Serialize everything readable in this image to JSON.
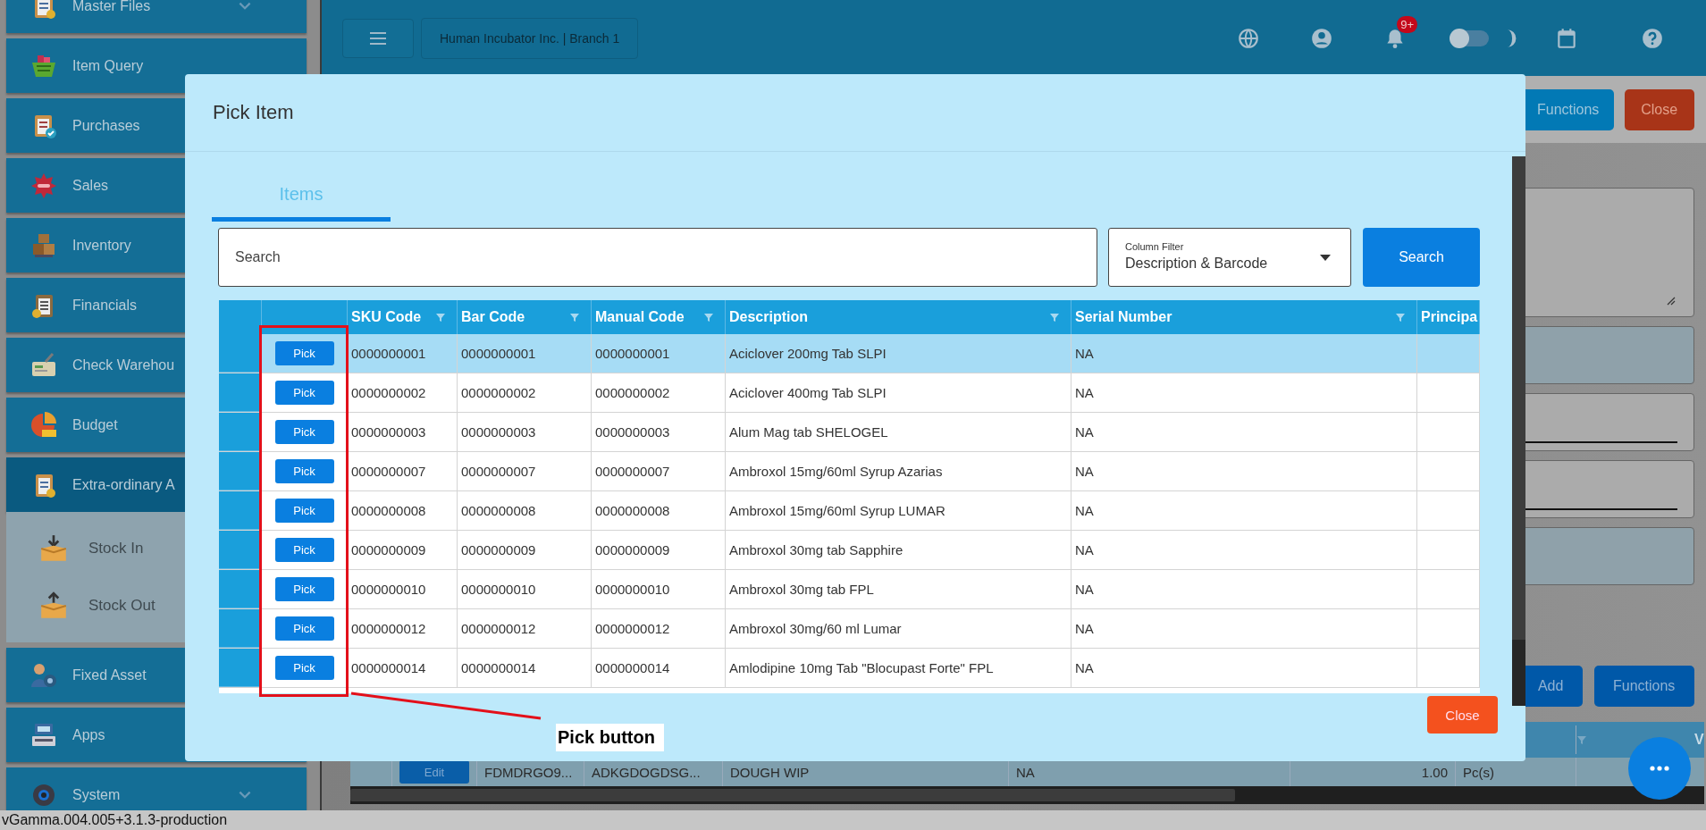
{
  "sidebar": {
    "items": [
      {
        "label": "Master Files",
        "caret": true,
        "expanded": false
      },
      {
        "label": "Item Query",
        "expanded": false
      },
      {
        "label": "Purchases",
        "expanded": false
      },
      {
        "label": "Sales",
        "expanded": false
      },
      {
        "label": "Inventory",
        "expanded": false
      },
      {
        "label": "Financials",
        "expanded": false
      },
      {
        "label": "Check Warehou",
        "expanded": false
      },
      {
        "label": "Budget",
        "expanded": false
      },
      {
        "label": "Extra-ordinary A",
        "expanded": true,
        "children": [
          {
            "label": "Stock In"
          },
          {
            "label": "Stock Out"
          }
        ]
      },
      {
        "label": "Fixed Asset",
        "expanded": false
      },
      {
        "label": "Apps",
        "expanded": false
      },
      {
        "label": "System",
        "caret": true,
        "expanded": false
      }
    ]
  },
  "top_bar": {
    "company": "Human Incubator Inc. | Branch 1",
    "notification_count": "9+",
    "theme_toggle": {
      "on": false
    }
  },
  "page": {
    "top_buttons": [
      "Functions",
      "Close"
    ],
    "lower_buttons": [
      "Add",
      "Functions"
    ],
    "table": {
      "last_header": "V",
      "row": {
        "button": "Edit",
        "cells": [
          "FDMDRGO9...",
          "ADKGDOGDSG...",
          "DOUGH WIP",
          "NA",
          "1.00",
          "Pc(s)"
        ]
      }
    }
  },
  "modal": {
    "title": "Pick Item",
    "tabs": [
      {
        "label": "Items",
        "selected": true
      }
    ],
    "search": {
      "placeholder": "Search"
    },
    "column_filter": {
      "label": "Column Filter",
      "value": "Description & Barcode"
    },
    "search_button": "Search",
    "table": {
      "columns": [
        {
          "label": "SKU Code",
          "filter": true
        },
        {
          "label": "Bar Code",
          "filter": true
        },
        {
          "label": "Manual Code",
          "filter": true
        },
        {
          "label": "Description",
          "filter": true
        },
        {
          "label": "Serial Number",
          "filter": true
        },
        {
          "label": "Principa"
        }
      ],
      "rows": [
        {
          "pick": "Pick",
          "selected": true,
          "cells": [
            "0000000001",
            "0000000001",
            "0000000001",
            "Aciclover 200mg Tab SLPI",
            "NA"
          ]
        },
        {
          "pick": "Pick",
          "selected": false,
          "cells": [
            "0000000002",
            "0000000002",
            "0000000002",
            "Aciclover 400mg Tab SLPI",
            "NA"
          ]
        },
        {
          "pick": "Pick",
          "selected": false,
          "cells": [
            "0000000003",
            "0000000003",
            "0000000003",
            "Alum Mag tab SHELOGEL",
            "NA"
          ]
        },
        {
          "pick": "Pick",
          "selected": false,
          "cells": [
            "0000000007",
            "0000000007",
            "0000000007",
            "Ambroxol 15mg/60ml Syrup Azarias",
            "NA"
          ]
        },
        {
          "pick": "Pick",
          "selected": false,
          "cells": [
            "0000000008",
            "0000000008",
            "0000000008",
            "Ambroxol 15mg/60ml Syrup LUMAR",
            "NA"
          ]
        },
        {
          "pick": "Pick",
          "selected": false,
          "cells": [
            "0000000009",
            "0000000009",
            "0000000009",
            "Ambroxol 30mg tab Sapphire",
            "NA"
          ]
        },
        {
          "pick": "Pick",
          "selected": false,
          "cells": [
            "0000000010",
            "0000000010",
            "0000000010",
            "Ambroxol 30mg tab FPL",
            "NA"
          ]
        },
        {
          "pick": "Pick",
          "selected": false,
          "cells": [
            "0000000012",
            "0000000012",
            "0000000012",
            "Ambroxol 30mg/60 ml Lumar",
            "NA"
          ]
        },
        {
          "pick": "Pick",
          "selected": false,
          "cells": [
            "0000000014",
            "0000000014",
            "0000000014",
            "Amlodipine 10mg Tab \"Blocupast Forte\" FPL",
            "NA"
          ]
        }
      ]
    },
    "close_button": "Close"
  },
  "annotation": {
    "label": "Pick button"
  },
  "version": "vGamma.004.005+3.1.3-production"
}
